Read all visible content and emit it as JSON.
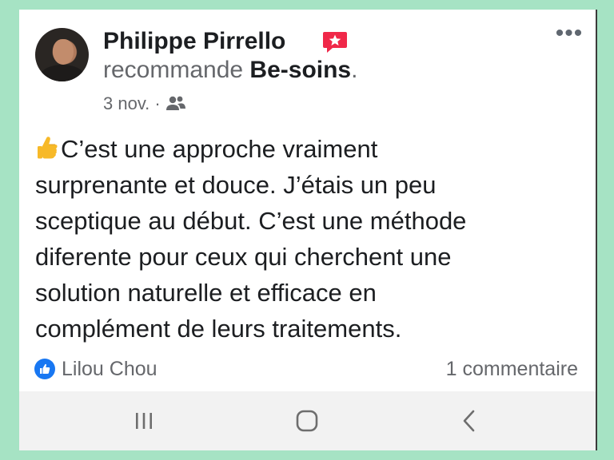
{
  "post": {
    "author_name": "Philippe Pirrello",
    "recommend_verb": "recommande",
    "page_name": "Be-soins",
    "page_suffix": ".",
    "date": "3 nov.",
    "separator": "·",
    "privacy_icon": "friends-icon",
    "recommend_icon": "recommendation-star-icon",
    "more_label": "•••",
    "body_lines": [
      "C’est une approche vraiment",
      "surprenante et douce. J’étais un peu",
      "sceptique au début. C’est une méthode",
      "diferente pour ceux qui cherchent une",
      "solution naturelle et efficace en",
      "complément de leurs traitements."
    ],
    "body_emoji": "thumbs-up-emoji",
    "reaction_icon": "like-icon",
    "reactor_name": "Lilou Chou",
    "comments_label": "1 commentaire"
  },
  "navbar": {
    "recent_icon": "recent-apps-icon",
    "home_icon": "home-icon",
    "back_icon": "back-icon"
  },
  "colors": {
    "background": "#a6e3c4",
    "recommend_badge": "#f02849",
    "like_blue": "#1877f2",
    "text_primary": "#1c1e21",
    "text_secondary": "#65676b"
  }
}
